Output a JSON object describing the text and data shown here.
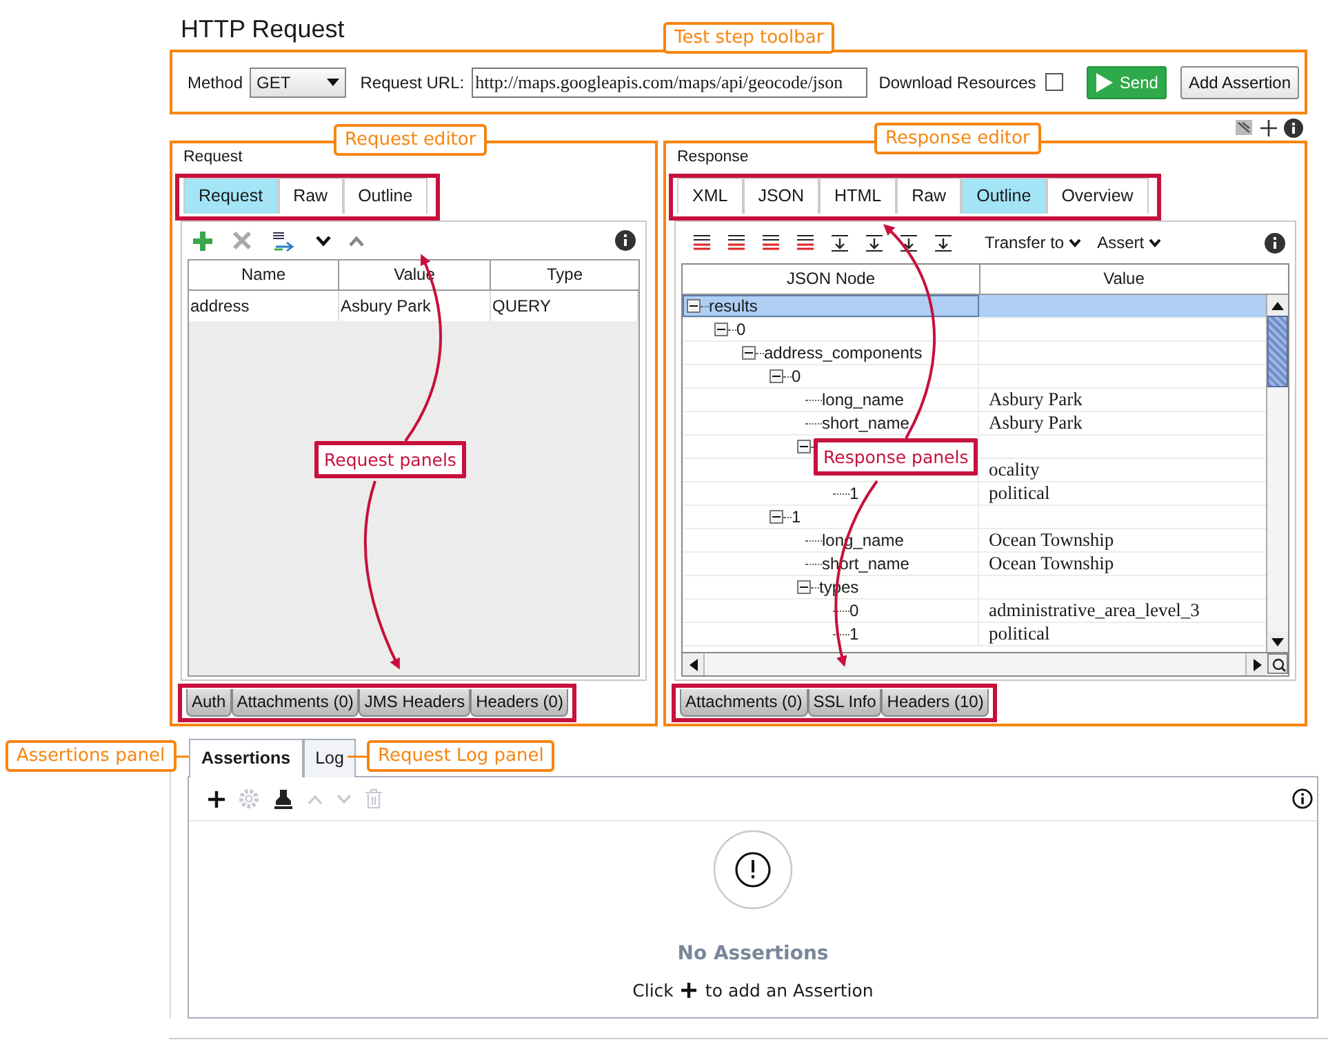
{
  "title": "HTTP Request",
  "toolbar": {
    "method_label": "Method",
    "method": "GET",
    "url_label": "Request URL:",
    "url": "http://maps.googleapis.com/maps/api/geocode/json",
    "download_label": "Download Resources",
    "download_checked": false,
    "send_label": "Send",
    "add_assertion_label": "Add Assertion"
  },
  "request_editor": {
    "title": "Request",
    "tabs": [
      {
        "label": "Request",
        "selected": true
      },
      {
        "label": "Raw",
        "selected": false
      },
      {
        "label": "Outline",
        "selected": false
      }
    ],
    "tools": [
      {
        "kind": "add",
        "disabled": false
      },
      {
        "kind": "remove",
        "disabled": true
      },
      {
        "kind": "encode",
        "disabled": false
      },
      {
        "kind": "down",
        "disabled": false
      },
      {
        "kind": "up",
        "disabled": true
      }
    ],
    "columns": [
      "Name",
      "Value",
      "Type"
    ],
    "rows": [
      [
        "address",
        "Asbury Park",
        "QUERY"
      ]
    ],
    "panel_tabs": [
      {
        "label": "Auth",
        "selected": false
      },
      {
        "label": "Attachments (0)",
        "selected": false
      },
      {
        "label": "JMS Headers",
        "selected": false
      },
      {
        "label": "Headers (0)",
        "selected": false
      }
    ]
  },
  "response_editor": {
    "title": "Response",
    "tabs": [
      {
        "label": "XML",
        "selected": false
      },
      {
        "label": "JSON",
        "selected": false
      },
      {
        "label": "HTML",
        "selected": false
      },
      {
        "label": "Raw",
        "selected": false
      },
      {
        "label": "Outline",
        "selected": true
      },
      {
        "label": "Overview",
        "selected": false
      }
    ],
    "transfer_label": "Transfer to",
    "assert_label": "Assert",
    "columns": [
      "JSON Node",
      "Value"
    ],
    "nodes": [
      {
        "name": "results",
        "expanded": true,
        "selected": true,
        "children": [
          {
            "name": "0",
            "expanded": true,
            "selected": false,
            "children": [
              {
                "name": "address_components",
                "expanded": true,
                "selected": false,
                "children": [
                  {
                    "name": "0",
                    "expanded": true,
                    "selected": false,
                    "children": [
                      {
                        "name": "long_name",
                        "value": "Asbury Park",
                        "selected": false
                      },
                      {
                        "name": "short_name",
                        "value": "Asbury Park",
                        "selected": false
                      },
                      {
                        "expanded": true,
                        "selected": false,
                        "children": [
                          {
                            "value": "ocality",
                            "selected": false
                          },
                          {
                            "name": "1",
                            "value": "political",
                            "selected": false
                          }
                        ]
                      }
                    ]
                  },
                  {
                    "name": "1",
                    "expanded": true,
                    "selected": false,
                    "children": [
                      {
                        "name": "long_name",
                        "value": "Ocean Township",
                        "selected": false
                      },
                      {
                        "name": "short_name",
                        "value": "Ocean Township",
                        "selected": false
                      },
                      {
                        "name": "types",
                        "expanded": true,
                        "selected": false,
                        "children": [
                          {
                            "name": "0",
                            "value": "administrative_area_level_3",
                            "selected": false
                          },
                          {
                            "name": "1",
                            "value": "political",
                            "selected": false
                          }
                        ]
                      }
                    ]
                  }
                ]
              }
            ]
          }
        ]
      }
    ],
    "panel_tabs": [
      {
        "label": "Attachments (0)",
        "selected": false
      },
      {
        "label": "SSL Info",
        "selected": false
      },
      {
        "label": "Headers (10)",
        "selected": false
      }
    ]
  },
  "assertions": {
    "tabs": [
      {
        "label": "Assertions",
        "selected": true
      },
      {
        "label": "Log",
        "selected": false
      }
    ],
    "tools": [
      {
        "kind": "add",
        "disabled": false
      },
      {
        "kind": "settings",
        "disabled": true
      },
      {
        "kind": "stamp",
        "disabled": false
      },
      {
        "kind": "up",
        "disabled": true
      },
      {
        "kind": "down",
        "disabled": true
      },
      {
        "kind": "delete",
        "disabled": true
      }
    ],
    "empty_title": "No Assertions",
    "hint_before": "Click",
    "hint_after": "to add an Assertion"
  },
  "annotations": [
    {
      "text": "Test step toolbar",
      "kind": "callout"
    },
    {
      "text": "Request editor",
      "kind": "callout"
    },
    {
      "text": "Response editor",
      "kind": "callout"
    },
    {
      "text": "Request panels",
      "kind": "highlight"
    },
    {
      "text": "Response panels",
      "kind": "highlight"
    },
    {
      "text": "Assertions panel",
      "kind": "callout"
    },
    {
      "text": "Request Log panel",
      "kind": "callout"
    }
  ]
}
